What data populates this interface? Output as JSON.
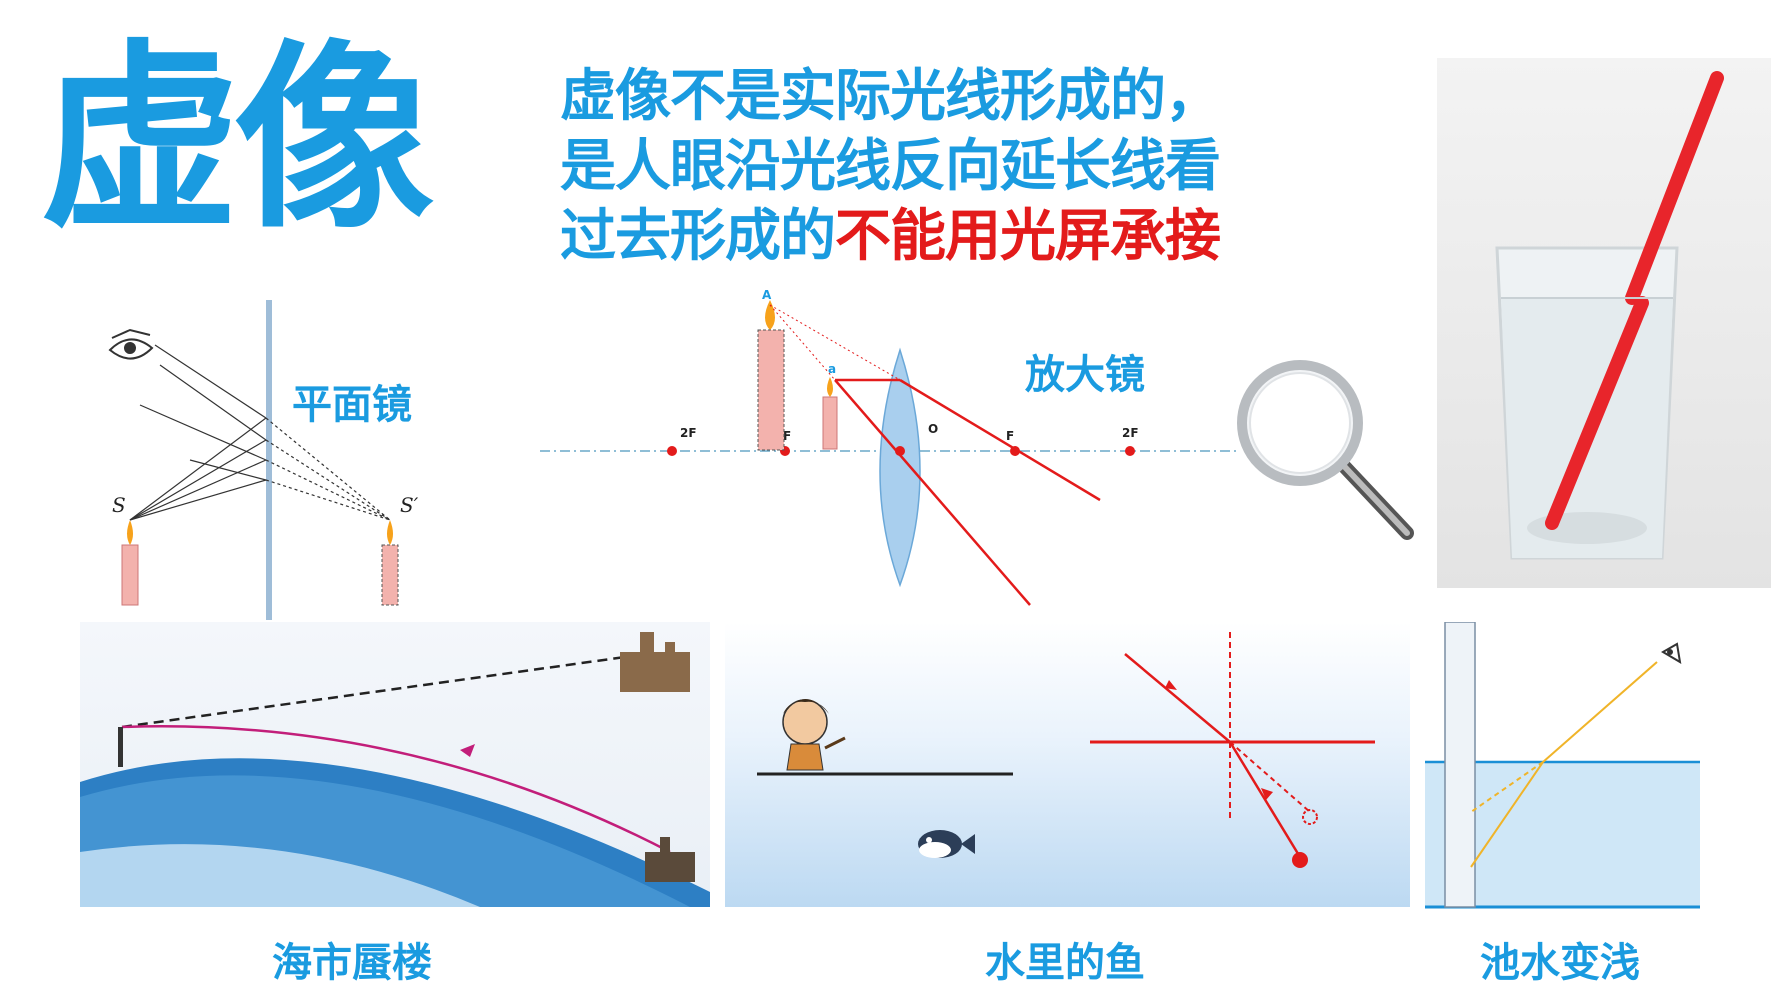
{
  "title": "虚像",
  "description": {
    "line1": "虚像不是实际光线形成的，",
    "line2": "是人眼沿光线反向延长线看",
    "line3_prefix": "过去形成的",
    "line3_highlight": "不能用光屏承接"
  },
  "plane_mirror": {
    "label": "平面镜",
    "source_label": "S",
    "image_label": "S′"
  },
  "magnifier": {
    "label": "放大镜",
    "points": {
      "A": "A",
      "a": "a",
      "O": "O",
      "F_left": "F",
      "F_right": "F",
      "2F_left": "2F",
      "2F_right": "2F"
    }
  },
  "captions": {
    "mirage": "海市蜃楼",
    "fish": "水里的鱼",
    "pool": "池水变浅"
  },
  "colors": {
    "accent": "#1a9be0",
    "highlight": "#e31b1b",
    "ray": "#e31b1b",
    "water": "#bcd9f2"
  }
}
